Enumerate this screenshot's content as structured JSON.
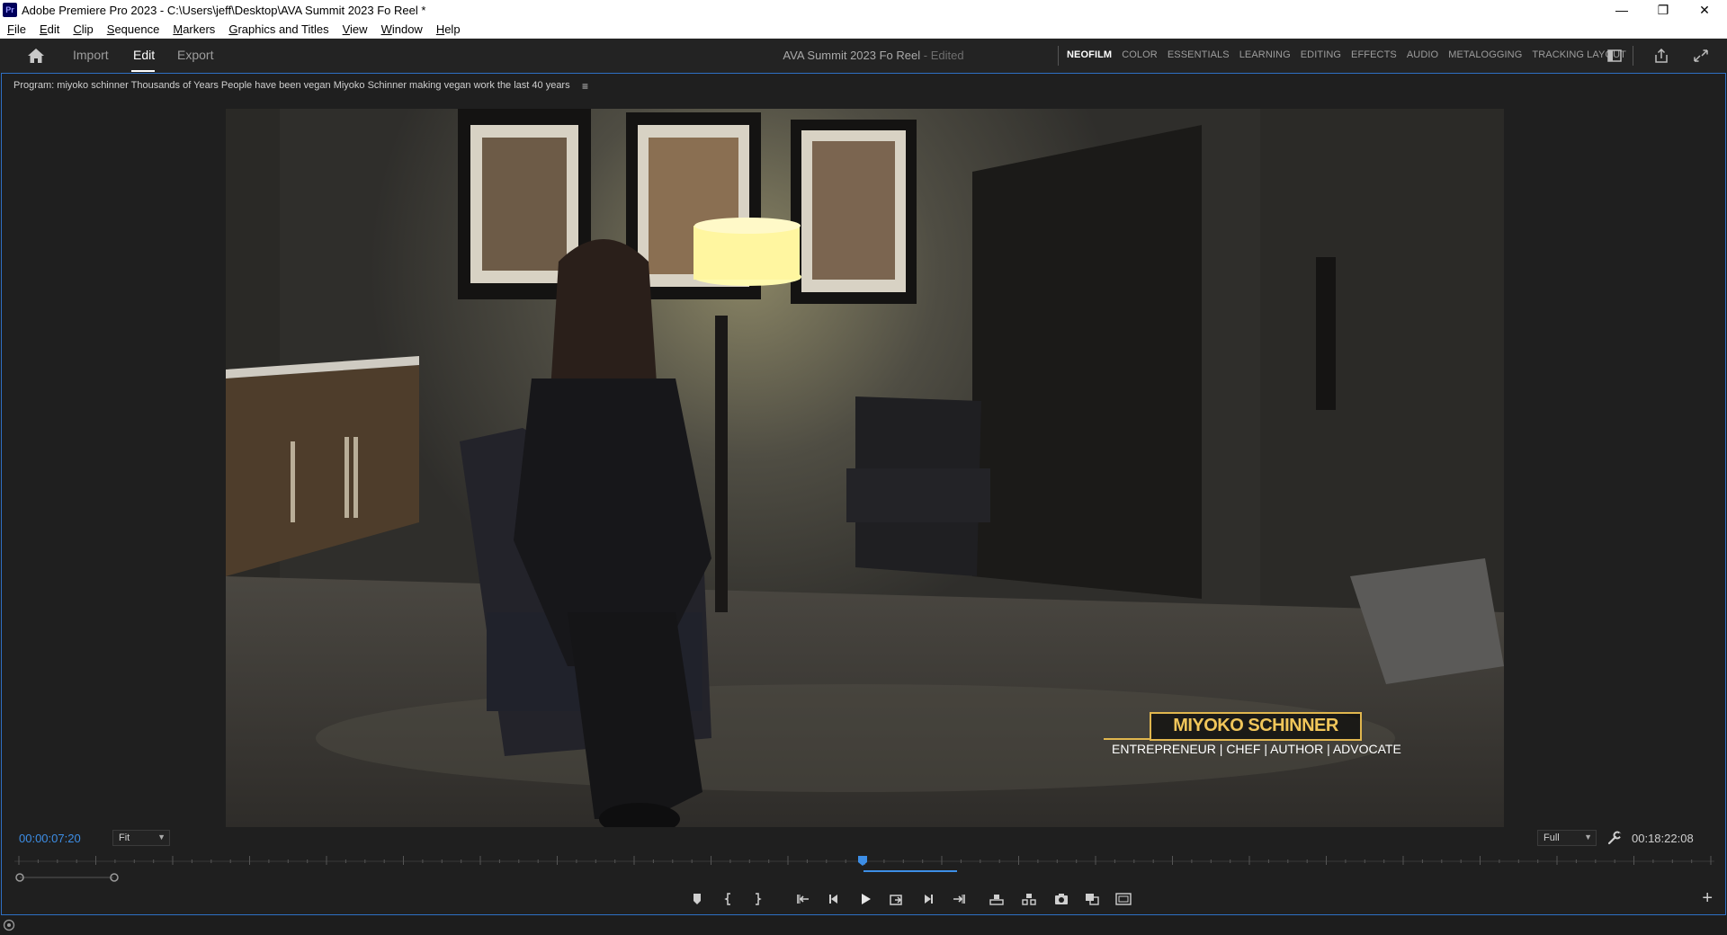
{
  "window": {
    "app_icon": "Pr",
    "title": "Adobe Premiere Pro 2023 - C:\\Users\\jeff\\Desktop\\AVA Summit 2023 Fo Reel *",
    "controls": {
      "minimize": "—",
      "maximize": "❐",
      "close": "✕"
    }
  },
  "menu": [
    "File",
    "Edit",
    "Clip",
    "Sequence",
    "Markers",
    "Graphics and Titles",
    "View",
    "Window",
    "Help"
  ],
  "header": {
    "tabs": [
      "Import",
      "Edit",
      "Export"
    ],
    "active_tab": "Edit",
    "project_name": "AVA Summit 2023 Fo Reel",
    "project_status": "- Edited",
    "workspaces": [
      "NEOFILM",
      "COLOR",
      "ESSENTIALS",
      "LEARNING",
      "EDITING",
      "EFFECTS",
      "AUDIO",
      "METALOGGING",
      "TRACKING LAYOUT"
    ],
    "active_workspace": "NEOFILM"
  },
  "monitor": {
    "tab_label": "Program: miyoko schinner Thousands of Years People have been vegan Miyoko Schinner making vegan work the last 40 years",
    "menu_icon": "≡",
    "lower_third": {
      "name": "MIYOKO SCHINNER",
      "titles": "ENTREPRENEUR | CHEF | AUTHOR | ADVOCATE"
    },
    "timecode_current": "00:00:07:20",
    "zoom": "Fit",
    "resolution": "Full",
    "timecode_duration": "00:18:22:08",
    "playhead_fraction": 0.007,
    "add_button": "+"
  },
  "colors": {
    "accent_blue": "#2e6fc4",
    "timecode_blue": "#3d8ee6",
    "lower_third_gold": "#e0b64e"
  }
}
